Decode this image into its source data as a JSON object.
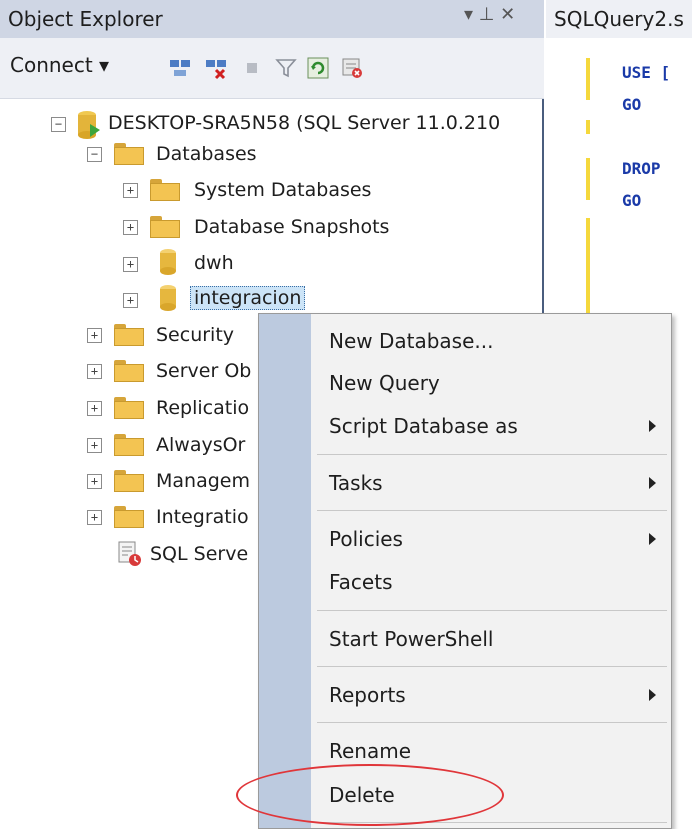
{
  "object_explorer": {
    "title": "Object Explorer",
    "pin_controls": "▾ ⊥ ✕",
    "toolbar": {
      "connect_label": "Connect ▾"
    },
    "server_node": "DESKTOP-SRA5N58 (SQL Server 11.0.210",
    "databases_folder": "Databases",
    "database_children": [
      "System Databases",
      "Database Snapshots",
      "dwh",
      "integracion"
    ],
    "top_level_folders": [
      "Security",
      "Server Ob",
      "Replicatio",
      "AlwaysOr",
      "Managem",
      "Integratio"
    ],
    "sql_agent": "SQL Serve"
  },
  "query_tab": {
    "title": "SQLQuery2.s",
    "lines": [
      "USE [",
      "GO",
      "",
      "DROP",
      "GO"
    ]
  },
  "context_menu": {
    "items": [
      "New Database...",
      "New Query",
      "Script Database as",
      "Tasks",
      "Policies",
      "Facets",
      "Start PowerShell",
      "Reports",
      "Rename",
      "Delete"
    ],
    "submenu_items": [
      "Script Database as",
      "Tasks",
      "Policies",
      "Reports"
    ],
    "highlighted_item": "Delete"
  },
  "colors": {
    "title_bg": "#cfd6e4",
    "menu_strip": "#bccadf",
    "highlight_ring": "#e0363a",
    "selection": "#cce4f7"
  }
}
